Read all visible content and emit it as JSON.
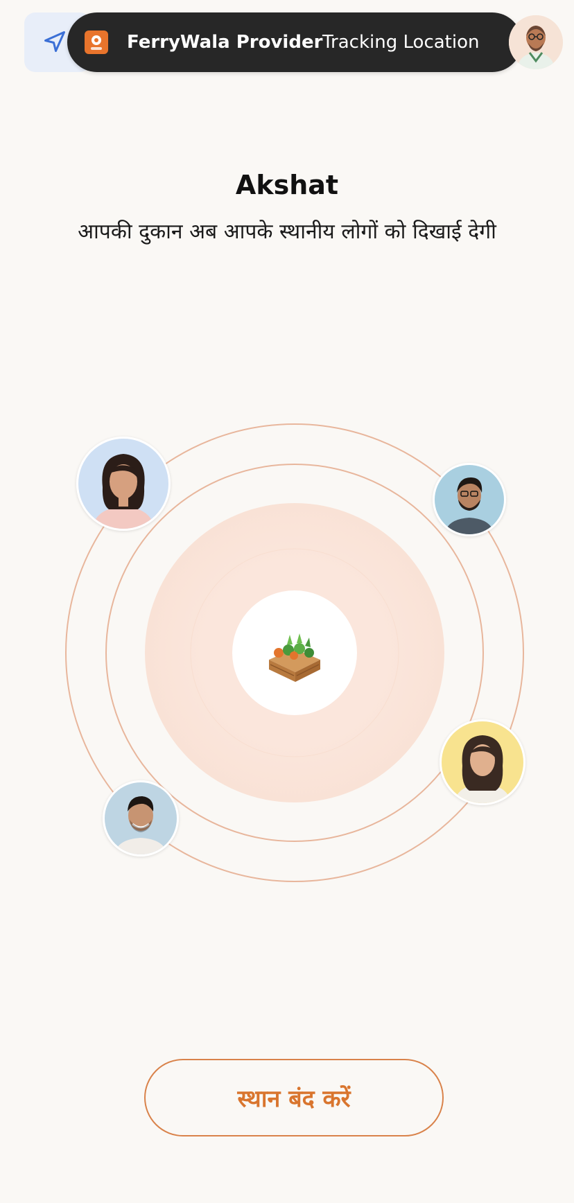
{
  "notification": {
    "app_name": "FerryWala Provider",
    "message": "Tracking Location",
    "icon": "ferrywala-app-icon"
  },
  "header": {
    "nav_icon": "navigation-arrow-icon",
    "profile_icon": "profile-avatar"
  },
  "main": {
    "user_name": "Akshat",
    "tagline": "आपकी दुकान अब आपके स्थानीय लोगों को दिखाई देगी"
  },
  "radar": {
    "center_icon": "vegetable-crate-icon",
    "avatars": [
      "customer-avatar-woman-top-left",
      "customer-avatar-man-top-right",
      "customer-avatar-woman-right",
      "customer-avatar-man-bottom-left"
    ]
  },
  "actions": {
    "stop_location_label": "स्थान बंद करें"
  },
  "colors": {
    "accent": "#d9752e",
    "background": "#faf8f5",
    "notification_bg": "#272727"
  }
}
